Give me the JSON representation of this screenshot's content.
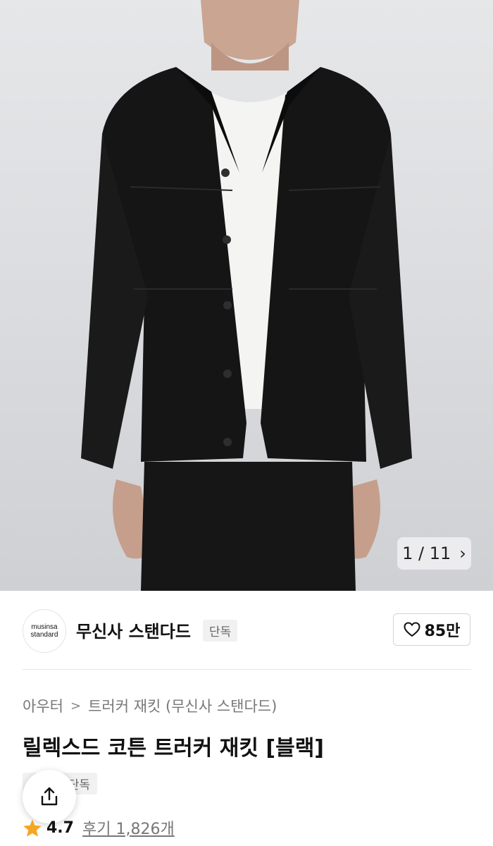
{
  "gallery": {
    "current": "1",
    "total": "11",
    "counter_text": "1 / 11"
  },
  "brand": {
    "logo_line1": "musinsa",
    "logo_line2": "standard",
    "name": "무신사 스탠다드",
    "badge": "단독",
    "likes": "85만"
  },
  "breadcrumb": {
    "category": "아우터",
    "subcategory": "트러커 재킷 (무신사 스탠다드)"
  },
  "product": {
    "title": "릴렉스드 코튼 트러커 재킷 [블랙]",
    "tag": "단독",
    "rating": "4.7",
    "reviews": "후기 1,826개"
  },
  "colors": {
    "star": "#f5a623",
    "text_dark": "#111111",
    "text_muted": "#777777"
  },
  "icons": [
    "chevron-right-icon",
    "heart-icon",
    "share-icon",
    "star-icon"
  ]
}
